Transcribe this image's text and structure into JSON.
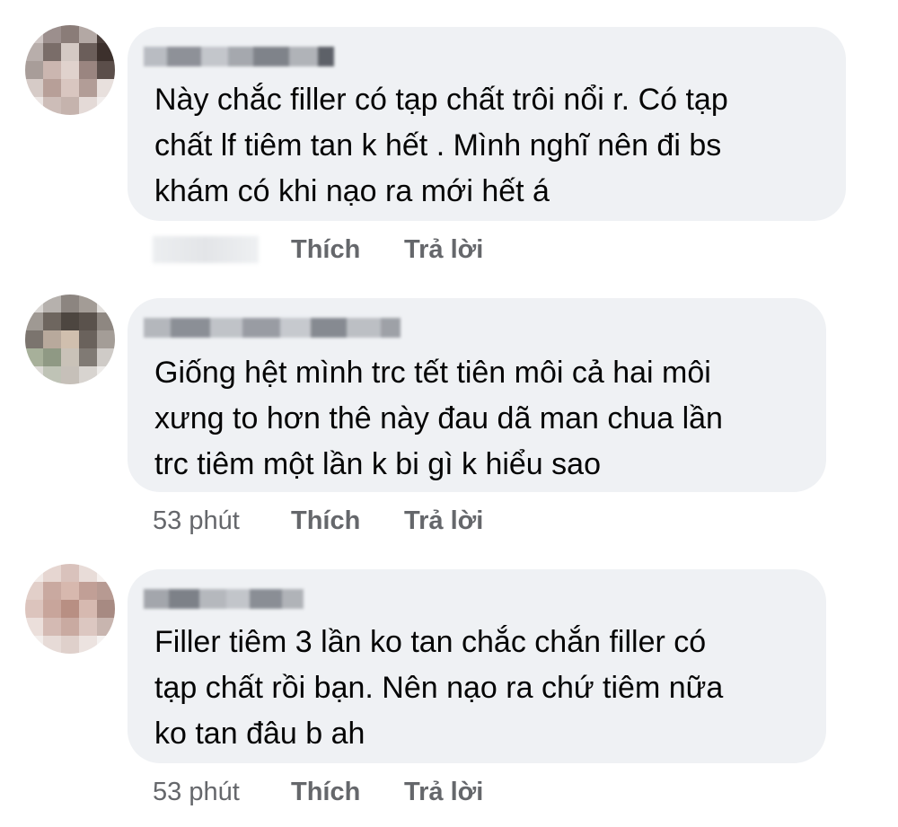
{
  "comments": [
    {
      "text": "Này chắc filler có tạp chất trôi nổi r. Có tạp\nchất lf tiêm tan k hết . Mình nghĩ nên đi bs\nkhám có khi nạo ra mới hết á",
      "time": "",
      "like_label": "Thích",
      "reply_label": "Trả lời"
    },
    {
      "text": "Giống hệt mình trc tết tiên môi cả hai môi\nxưng to hơn thê này đau dã man chua lần\ntrc tiêm một lần k bi gì k hiểu sao",
      "time": "53 phút",
      "like_label": "Thích",
      "reply_label": "Trả lời"
    },
    {
      "text": "Filler tiêm 3 lần ko tan chắc chắn filler có\ntạp chất rồi bạn. Nên nạo ra chứ tiêm nữa\nko tan đâu b ah",
      "time": "53 phút",
      "like_label": "Thích",
      "reply_label": "Trả lời"
    }
  ],
  "colors": {
    "bubble": "#eff1f4",
    "text": "#050505",
    "meta": "#65676b"
  }
}
